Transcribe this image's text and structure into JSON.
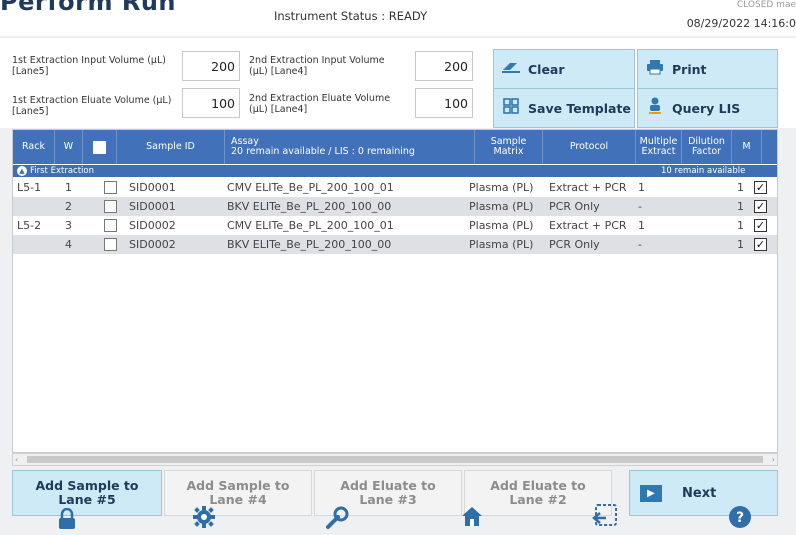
{
  "header": {
    "title": "Perform Run",
    "instrument_status": "Instrument Status : READY",
    "top_right_status": "CLOSED mae",
    "datetime": "08/29/2022 14:16:0"
  },
  "params": {
    "first_input_label": "1st Extraction Input Volume (µL) [Lane5]",
    "first_input_value": "200",
    "first_eluate_label": "1st Extraction Eluate Volume (µL) [Lane5]",
    "first_eluate_value": "100",
    "second_input_label": "2nd Extraction Input Volume (µL) [Lane4]",
    "second_input_value": "200",
    "second_eluate_label": "2nd Extraction Eluate Volume (µL) [Lane4]",
    "second_eluate_value": "100"
  },
  "actions": {
    "clear": "Clear",
    "print": "Print",
    "save_template": "Save Template",
    "query_lis": "Query LIS"
  },
  "table": {
    "headers": {
      "rack": "Rack",
      "well": "W",
      "sample_id": "Sample ID",
      "assay_title": "Assay",
      "assay_sub": "20 remain available / LIS : 0 remaining",
      "sample_matrix_1": "Sample",
      "sample_matrix_2": "Matrix",
      "protocol": "Protocol",
      "multiple_1": "Multiple",
      "multiple_2": "Extract",
      "dilution_1": "Dilution",
      "dilution_2": "Factor",
      "m": "M"
    },
    "group": {
      "title": "First Extraction",
      "right": "10 remain available"
    },
    "rows": [
      {
        "rack": "L5-1",
        "well": "1",
        "sample_id": "SID0001",
        "assay": "CMV ELITe_Be_PL_200_100_01",
        "matrix": "Plasma (PL)",
        "protocol": "Extract + PCR",
        "multiple": "1",
        "dilution": "1",
        "m": "✓"
      },
      {
        "rack": "",
        "well": "2",
        "sample_id": "SID0001",
        "assay": "BKV ELITe_Be_PL_200_100_00",
        "matrix": "Plasma (PL)",
        "protocol": "PCR Only",
        "multiple": "-",
        "dilution": "1",
        "m": "✓"
      },
      {
        "rack": "L5-2",
        "well": "3",
        "sample_id": "SID0002",
        "assay": "CMV ELITe_Be_PL_200_100_01",
        "matrix": "Plasma (PL)",
        "protocol": "Extract + PCR",
        "multiple": "1",
        "dilution": "1",
        "m": "✓"
      },
      {
        "rack": "",
        "well": "4",
        "sample_id": "SID0002",
        "assay": "BKV ELITe_Be_PL_200_100_00",
        "matrix": "Plasma (PL)",
        "protocol": "PCR Only",
        "multiple": "-",
        "dilution": "1",
        "m": "✓"
      }
    ]
  },
  "bottom": {
    "add_lane5": "Add Sample to Lane #5",
    "add_lane4": "Add Sample to Lane #4",
    "add_eluate3": "Add Eluate to Lane #3",
    "add_eluate2": "Add Eluate to Lane #2",
    "next": "Next"
  },
  "icons": {
    "clear": "eraser-icon",
    "print": "printer-icon",
    "save_template": "grid-template-icon",
    "query_lis": "person-icon",
    "next": "arrow-right-icon",
    "footer": [
      "lock-icon",
      "gear-icon",
      "wrench-icon",
      "home-icon",
      "exit-icon",
      "help-icon"
    ]
  },
  "colors": {
    "header_blue": "#4172b9",
    "button_light_blue": "#cdeaf6",
    "row_alt": "#dde1e6"
  }
}
